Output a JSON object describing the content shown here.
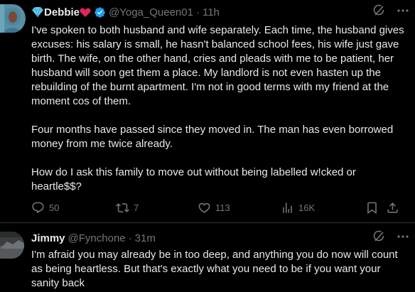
{
  "colors": {
    "background": "#000000",
    "text": "#e7e9ea",
    "muted": "#71767b",
    "verified": "#1d9bf0",
    "divider": "#2f3336"
  },
  "posts": [
    {
      "author": {
        "name": "Debbie",
        "handle": "@Yoga_Queen01",
        "name_emojis": [
          "diamond-icon",
          "heart-icon"
        ],
        "verified": true
      },
      "separator": "·",
      "time": "11h",
      "text": "I've spoken to both husband and wife separately. Each time, the husband gives excuses: his salary is small, he hasn't balanced school fees, his wife just gave birth. The wife, on the other hand, cries and pleads with me to be patient, her husband will soon get them a place. My landlord is not even hasten up the rebuilding of the burnt apartment. I'm not in good terms with my friend at the moment cos of them.\n\nFour months have passed since they moved in. The man has even borrowed money from me twice already.\n\nHow do I ask this family to move out without being labelled w!cked or heartle$$?",
      "metrics": {
        "replies": "50",
        "reposts": "7",
        "likes": "113",
        "views": "16K"
      }
    },
    {
      "author": {
        "name": "Jimmy",
        "handle": "@Fynchone"
      },
      "separator": "·",
      "time": "31m",
      "text": "I'm afraid you may already be in too deep, and anything you do now will count as being heartless. But that's exactly what you need to be if you want your sanity back"
    }
  ]
}
